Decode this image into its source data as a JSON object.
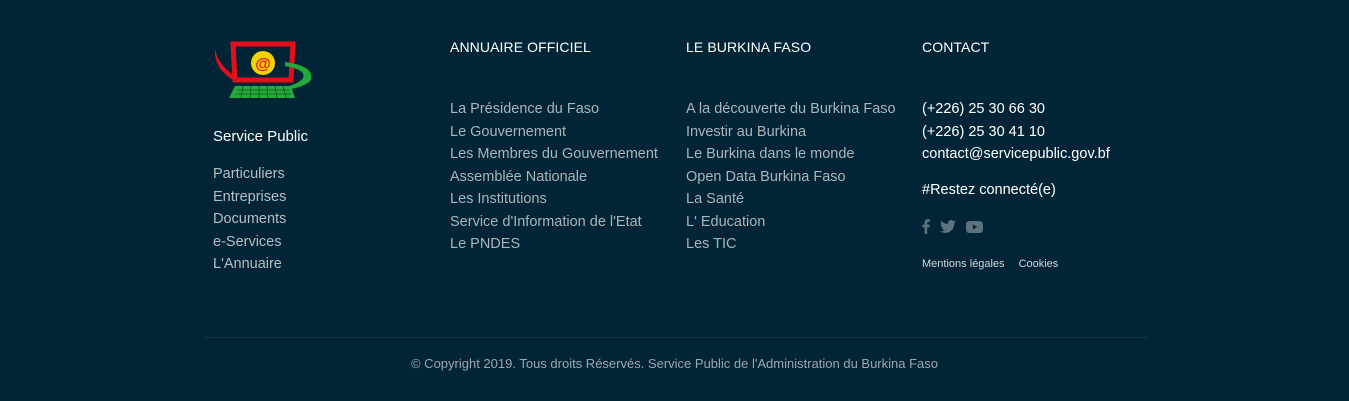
{
  "brand": {
    "name": "Service Public",
    "logo_icon": "at-sign-computer-logo",
    "colors": {
      "red": "#e3101b",
      "green": "#27a83b",
      "yellow": "#f5d300"
    }
  },
  "col1": {
    "links": [
      "Particuliers",
      "Entreprises",
      "Documents",
      "e-Services",
      "L'Annuaire"
    ]
  },
  "col2": {
    "title": "ANNUAIRE OFFICIEL",
    "links": [
      "La Présidence du Faso",
      "Le Gouvernement",
      "Les Membres du Gouvernement",
      "Assemblée Nationale",
      "Les Institutions",
      "Service d'Information de l'Etat",
      "Le PNDES"
    ]
  },
  "col3": {
    "title": "LE BURKINA FASO",
    "links": [
      "A la découverte du Burkina Faso",
      "Investir au Burkina",
      "Le Burkina dans le monde",
      "Open Data Burkina Faso",
      "La Santé",
      "L' Education",
      "Les TIC"
    ]
  },
  "contact": {
    "title": "CONTACT",
    "phone1": "(+226) 25 30 66 30",
    "phone2": "(+226) 25 30 41 10",
    "email": "contact@servicepublic.gov.bf",
    "social_title": "#Restez connecté(e)",
    "social_icons": [
      "facebook-icon",
      "twitter-icon",
      "youtube-icon"
    ],
    "legal": [
      "Mentions légales",
      "Cookies"
    ]
  },
  "copyright": "© Copyright 2019. Tous droits Réservés. Service Public de l'Administration du Burkina Faso",
  "theme": {
    "background": "#012536",
    "link": "#a9b4bb",
    "heading": "#ffffff"
  }
}
